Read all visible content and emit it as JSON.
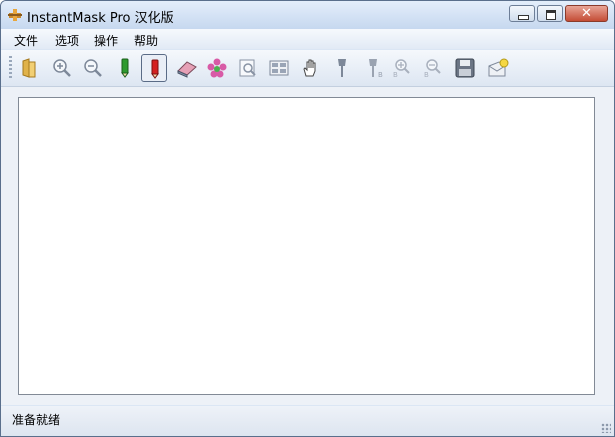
{
  "window": {
    "title": "InstantMask Pro 汉化版"
  },
  "menu": {
    "items": [
      "文件",
      "选项",
      "操作",
      "帮助"
    ]
  },
  "toolbar": {
    "buttons": [
      {
        "icon": "open-folder-icon"
      },
      {
        "icon": "zoom-in-icon"
      },
      {
        "icon": "zoom-out-icon"
      },
      {
        "icon": "green-pencil-icon"
      },
      {
        "icon": "red-pencil-icon",
        "state": "pressed"
      },
      {
        "icon": "eraser-icon"
      },
      {
        "icon": "flower-icon"
      },
      {
        "icon": "magnifier-page-icon"
      },
      {
        "icon": "view-grid-icon"
      },
      {
        "icon": "hand-pan-icon"
      },
      {
        "icon": "brush-icon"
      },
      {
        "icon": "brush-b-icon"
      },
      {
        "icon": "zoom-in-b-icon"
      },
      {
        "icon": "zoom-out-b-icon"
      },
      {
        "icon": "save-disk-icon"
      },
      {
        "icon": "export-image-icon"
      }
    ]
  },
  "status": {
    "text": "准备就绪"
  },
  "colors": {
    "titlebar": "#c6d8ef",
    "close": "#c44c35",
    "accent_red": "#d42020",
    "accent_green": "#2e9a2e"
  }
}
